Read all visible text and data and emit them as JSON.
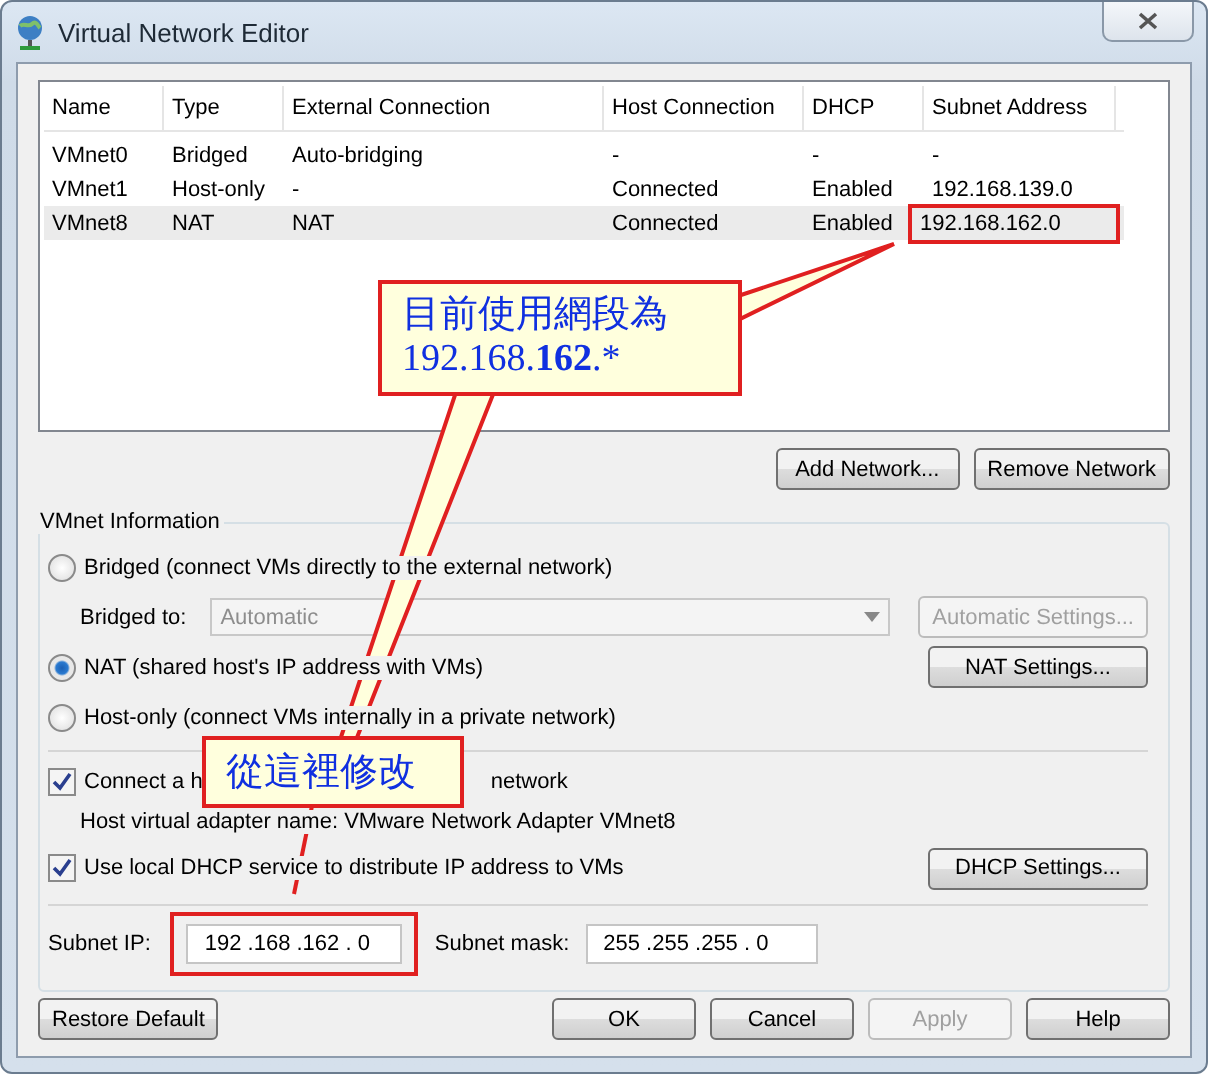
{
  "window": {
    "title": "Virtual Network Editor"
  },
  "table": {
    "columns": [
      "Name",
      "Type",
      "External Connection",
      "Host Connection",
      "DHCP",
      "Subnet Address"
    ],
    "rows": [
      {
        "cells": [
          "VMnet0",
          "Bridged",
          "Auto-bridging",
          "-",
          "-",
          "-"
        ],
        "selected": false,
        "subnet_highlighted": false
      },
      {
        "cells": [
          "VMnet1",
          "Host-only",
          "-",
          "Connected",
          "Enabled",
          "192.168.139.0"
        ],
        "selected": false,
        "subnet_highlighted": false
      },
      {
        "cells": [
          "VMnet8",
          "NAT",
          "NAT",
          "Connected",
          "Enabled",
          "192.168.162.0"
        ],
        "selected": true,
        "subnet_highlighted": true
      }
    ]
  },
  "network_buttons": [
    "Add Network...",
    "Remove Network"
  ],
  "vmnet_info": {
    "title": "VMnet Information",
    "modes": [
      {
        "label": "Bridged (connect VMs directly to the external network)",
        "selected": false
      },
      {
        "label": "NAT (shared host's IP address with VMs)",
        "selected": true
      },
      {
        "label": "Host-only (connect VMs internally in a private network)",
        "selected": false
      }
    ],
    "bridged_to": {
      "label": "Bridged to:",
      "value": "Automatic",
      "disabled": true
    },
    "automatic_settings": {
      "label": "Automatic Settings...",
      "disabled": true
    },
    "nat_settings": "NAT Settings...",
    "connect_adapter": {
      "label_start": "Connect a h",
      "label_end": "network",
      "checked": true
    },
    "adapter_name": "Host virtual adapter name: VMware Network Adapter VMnet8",
    "dhcp": {
      "label": "Use local DHCP service to distribute IP address to VMs",
      "checked": true
    },
    "dhcp_settings": "DHCP Settings...",
    "subnet_ip": {
      "label": "Subnet IP:",
      "value": "192 .168 .162 . 0"
    },
    "subnet_mask": {
      "label": "Subnet mask:",
      "value": "255 .255 .255 . 0"
    }
  },
  "footer_buttons": [
    {
      "label": "Restore Default",
      "disabled": false
    },
    {
      "label": "OK",
      "disabled": false
    },
    {
      "label": "Cancel",
      "disabled": false
    },
    {
      "label": "Apply",
      "disabled": true
    },
    {
      "label": "Help",
      "disabled": false
    }
  ],
  "annotations": [
    {
      "lines": [
        "目前使用網段為",
        "192.168.**162**.*"
      ]
    },
    {
      "lines": [
        "從這裡修改"
      ]
    }
  ]
}
